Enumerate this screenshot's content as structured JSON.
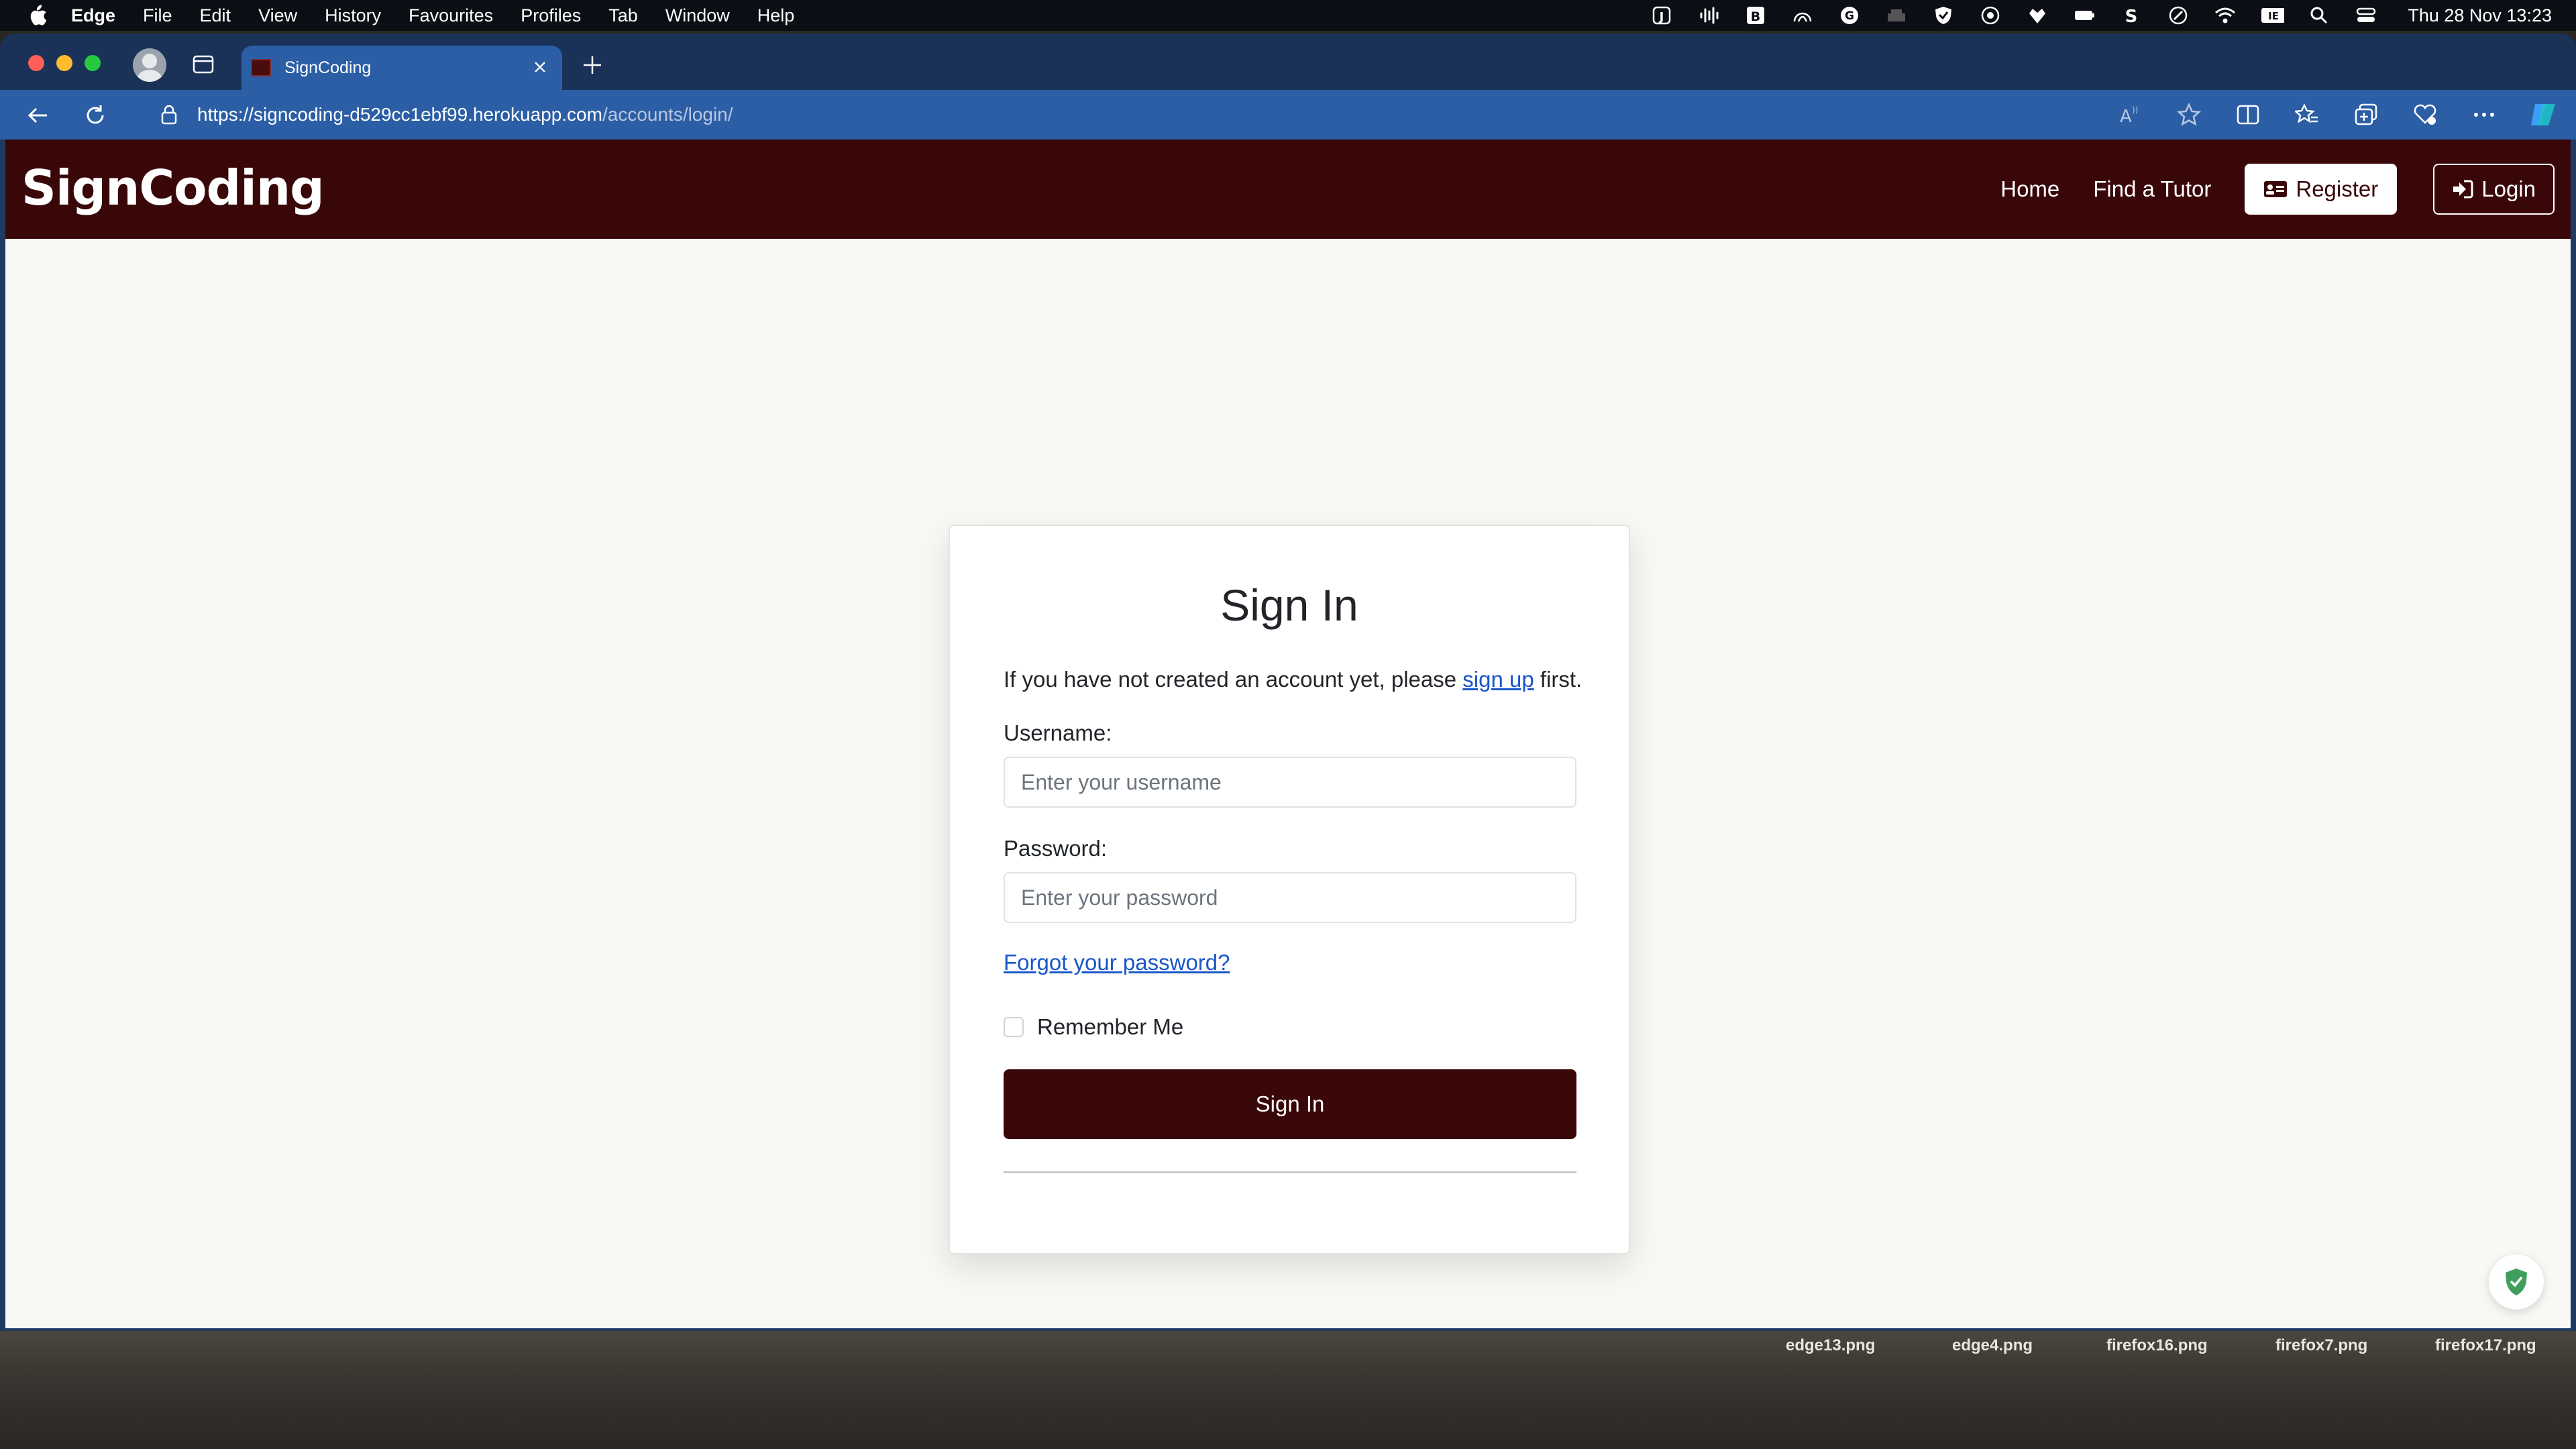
{
  "menubar": {
    "app": "Edge",
    "items": [
      "File",
      "Edit",
      "View",
      "History",
      "Favourites",
      "Profiles",
      "Tab",
      "Window",
      "Help"
    ],
    "clock": "Thu 28 Nov  13:23"
  },
  "browser": {
    "tab_title": "SignCoding",
    "url_host": "https://signcoding-d529cc1ebf99.herokuapp.com",
    "url_path": "/accounts/login/"
  },
  "site": {
    "brand": "SignCoding",
    "nav": {
      "home": "Home",
      "find_tutor": "Find a Tutor",
      "register": "Register",
      "login": "Login"
    }
  },
  "login": {
    "title": "Sign In",
    "intro_before": "If you have not created an account yet, please ",
    "intro_link": "sign up",
    "intro_after": " first.",
    "username_label": "Username:",
    "username_placeholder": "Enter your username",
    "password_label": "Password:",
    "password_placeholder": "Enter your password",
    "forgot": "Forgot your password?",
    "remember": "Remember Me",
    "submit": "Sign In"
  },
  "desktop_files": [
    "edge13.png",
    "edge4.png",
    "firefox16.png",
    "firefox7.png",
    "firefox17.png"
  ],
  "colors": {
    "brand": "#3a0709",
    "link": "#1a56c9",
    "tab_active": "#2b5ea5"
  }
}
